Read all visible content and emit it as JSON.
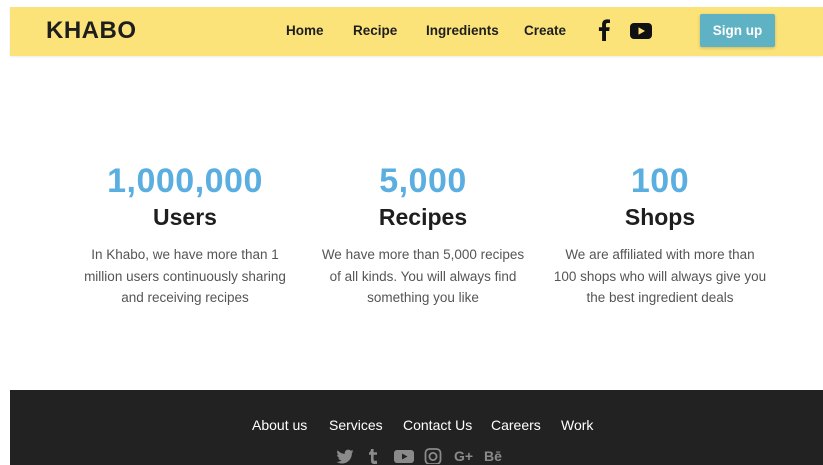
{
  "nav": {
    "brand": "KHABO",
    "links": [
      "Home",
      "Recipe",
      "Ingredients",
      "Create"
    ],
    "signup_label": "Sign up"
  },
  "stats": [
    {
      "number": "1,000,000",
      "label": "Users",
      "description": [
        "In Khabo, we have more than 1",
        "million users continuously sharing",
        "and receiving recipes"
      ]
    },
    {
      "number": "5,000",
      "label": "Recipes",
      "description": [
        "We have more than 5,000 recipes",
        "of all kinds. You will always find",
        "something you like"
      ]
    },
    {
      "number": "100",
      "label": "Shops",
      "description": [
        "We are affiliated with more than",
        "100 shops who will always give you",
        "the best ingredient deals"
      ]
    }
  ],
  "footer": {
    "links": [
      "About us",
      "Services",
      "Contact Us",
      "Careers",
      "Work"
    ],
    "social_text": {
      "googleplus": "G+",
      "behance": "Bē"
    }
  },
  "colors": {
    "nav_bg": "#fbe37a",
    "accent_blue": "#5aaee0",
    "button_bg": "#5fb1c4",
    "footer_bg": "#222222"
  },
  "icons": [
    "facebook-icon",
    "youtube-icon",
    "twitter-icon",
    "tumblr-icon",
    "instagram-icon",
    "googleplus-icon",
    "behance-icon"
  ]
}
